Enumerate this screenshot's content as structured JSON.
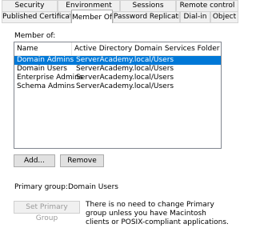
{
  "tabs_row1": [
    "Security",
    "Environment",
    "Sessions",
    "Remote control"
  ],
  "tabs_row2": [
    "Published Certificates",
    "Member Of",
    "Password Replication",
    "Dial-in",
    "Object"
  ],
  "active_tab": "Member Of",
  "member_of": {
    "label": "Member of:",
    "columns": [
      "Name",
      "Active Directory Domain Services Folder"
    ],
    "rows": [
      {
        "name": "Domain Admins",
        "folder": "ServerAcademy.local/Users",
        "selected": true
      },
      {
        "name": "Domain Users",
        "folder": "ServerAcademy.local/Users",
        "selected": false
      },
      {
        "name": "Enterprise Admins",
        "folder": "ServerAcademy.local/Users",
        "selected": false
      },
      {
        "name": "Schema Admins",
        "folder": "ServerAcademy.local/Users",
        "selected": false
      }
    ]
  },
  "buttons": {
    "add": "Add...",
    "remove": "Remove",
    "set_primary": "Set Primary Group"
  },
  "primary_group": {
    "label": "Primary group:",
    "value": "Domain Users",
    "note": "There is no need to change Primary group unless you have Macintosh clients or POSIX-compliant applications."
  },
  "colors": {
    "selection": "#0078d7",
    "button_face": "#e1e1e1",
    "tab_face": "#f0f0f0"
  }
}
